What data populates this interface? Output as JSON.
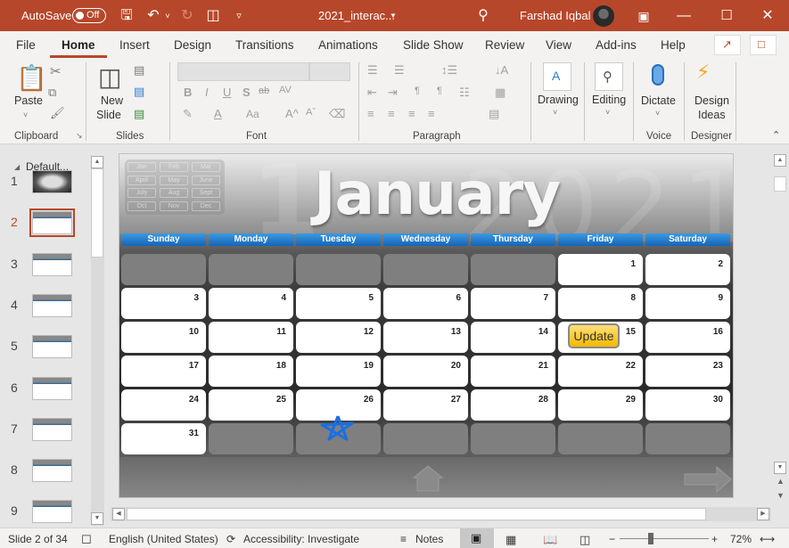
{
  "titlebar": {
    "autosave_label": "AutoSave",
    "autosave_state": "Off",
    "filename": "2021_interac...",
    "user_name": "Farshad Iqbal",
    "bg_color": "#b7472a"
  },
  "tabs": [
    "File",
    "Home",
    "Insert",
    "Design",
    "Transitions",
    "Animations",
    "Slide Show",
    "Review",
    "View",
    "Add-ins",
    "Help"
  ],
  "active_tab": "Home",
  "ribbon": {
    "clipboard": {
      "paste": "Paste",
      "label": "Clipboard"
    },
    "slides": {
      "new_slide_1": "New",
      "new_slide_2": "Slide",
      "label": "Slides"
    },
    "font": {
      "label": "Font",
      "bold": "B",
      "italic": "I",
      "underline": "U",
      "shadow": "S",
      "strike": "ab",
      "spacing": "AV",
      "case": "Aa",
      "grow": "A^",
      "shrink": "Aˇ"
    },
    "paragraph": {
      "label": "Paragraph"
    },
    "drawing": {
      "label": "Drawing"
    },
    "editing": {
      "label": "Editing"
    },
    "voice": {
      "dictate": "Dictate",
      "label": "Voice"
    },
    "designer": {
      "ideas_1": "Design",
      "ideas_2": "Ideas",
      "label": "Designer"
    }
  },
  "left_panel": {
    "section": "Default...",
    "slides": [
      {
        "num": "1"
      },
      {
        "num": "2",
        "selected": true
      },
      {
        "num": "3"
      },
      {
        "num": "4"
      },
      {
        "num": "5"
      },
      {
        "num": "6"
      },
      {
        "num": "7"
      },
      {
        "num": "8"
      },
      {
        "num": "9"
      }
    ]
  },
  "slide": {
    "month": "January",
    "year_bg": "2021",
    "month_nav": [
      "Jan",
      "Feb",
      "Mar",
      "April",
      "May",
      "June",
      "July",
      "Aug",
      "Sept",
      "Oct",
      "Nov",
      "Dec"
    ],
    "weekdays": [
      "Sunday",
      "Monday",
      "Tuesday",
      "Wednesday",
      "Thursday",
      "Friday",
      "Saturday"
    ],
    "weeks": [
      [
        "",
        "",
        "",
        "",
        "",
        "1",
        "2"
      ],
      [
        "3",
        "4",
        "5",
        "6",
        "7",
        "8",
        "9"
      ],
      [
        "10",
        "11",
        "12",
        "13",
        "14",
        "15",
        "16"
      ],
      [
        "17",
        "18",
        "19",
        "20",
        "21",
        "22",
        "23"
      ],
      [
        "24",
        "25",
        "26",
        "27",
        "28",
        "29",
        "30"
      ],
      [
        "31",
        "",
        "",
        "",
        "",
        "",
        ""
      ]
    ],
    "update_button": "Update",
    "star_color": "#1a6fe0"
  },
  "status": {
    "slide_counter": "Slide 2 of 34",
    "language": "English (United States)",
    "accessibility": "Accessibility: Investigate",
    "notes": "Notes",
    "zoom": "72%",
    "zoom_minus": "−",
    "zoom_plus": "+"
  }
}
